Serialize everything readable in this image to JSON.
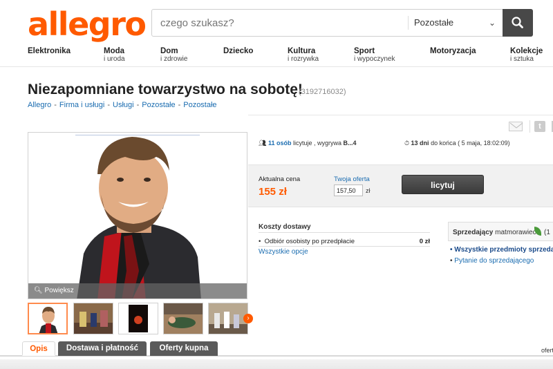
{
  "header": {
    "logo": "allegro",
    "search": {
      "placeholder": "czego szukasz?",
      "category": "Pozostałe"
    }
  },
  "nav": [
    {
      "main": "Elektronika",
      "sub": ""
    },
    {
      "main": "Moda",
      "sub": "i uroda"
    },
    {
      "main": "Dom",
      "sub": "i zdrowie"
    },
    {
      "main": "Dziecko",
      "sub": ""
    },
    {
      "main": "Kultura",
      "sub": "i rozrywka"
    },
    {
      "main": "Sport",
      "sub": "i wypoczynek"
    },
    {
      "main": "Motoryzacja",
      "sub": ""
    },
    {
      "main": "Kolekcje",
      "sub": "i sztuka"
    }
  ],
  "offer": {
    "title": "Niezapomniane towarzystwo na sobotę!",
    "id": "(3192716032)",
    "breadcrumbs": [
      "Allegro",
      "Firma i usługi",
      "Usługi",
      "Pozostałe",
      "Pozostałe"
    ]
  },
  "gallery": {
    "zoom_label": "Powiększ"
  },
  "stats": {
    "bidders_count": "11 osób",
    "bidders_text": " licytuje , wygrywa ",
    "winner": "B...4",
    "days_left": "13 dni",
    "days_text": " do końca ( 5 maja, 18:02:09)"
  },
  "pricing": {
    "current_label": "Aktualna cena",
    "current_price": "155 zł",
    "your_offer_label": "Twoja oferta",
    "your_offer_value": "157,50",
    "currency": "zł",
    "bid_button": "licytuj"
  },
  "shipping": {
    "title": "Koszty dostawy",
    "option_label": "Odbiór osobisty po przedpłacie",
    "option_price": "0 zł",
    "all_options": "Wszystkie opcje"
  },
  "seller": {
    "label": "Sprzedający",
    "name": "matmorawiec",
    "rating": "(1",
    "link_items": "Wszystkie przedmioty sprzeda",
    "link_question": "Pytanie do sprzedającego"
  },
  "tabs": [
    "Opis",
    "Dostawa i płatność",
    "Oferty kupna"
  ],
  "tabs_right": "ofert",
  "colors": {
    "accent": "#ff5a00",
    "link": "#1a6cb0",
    "button": "#484848"
  }
}
